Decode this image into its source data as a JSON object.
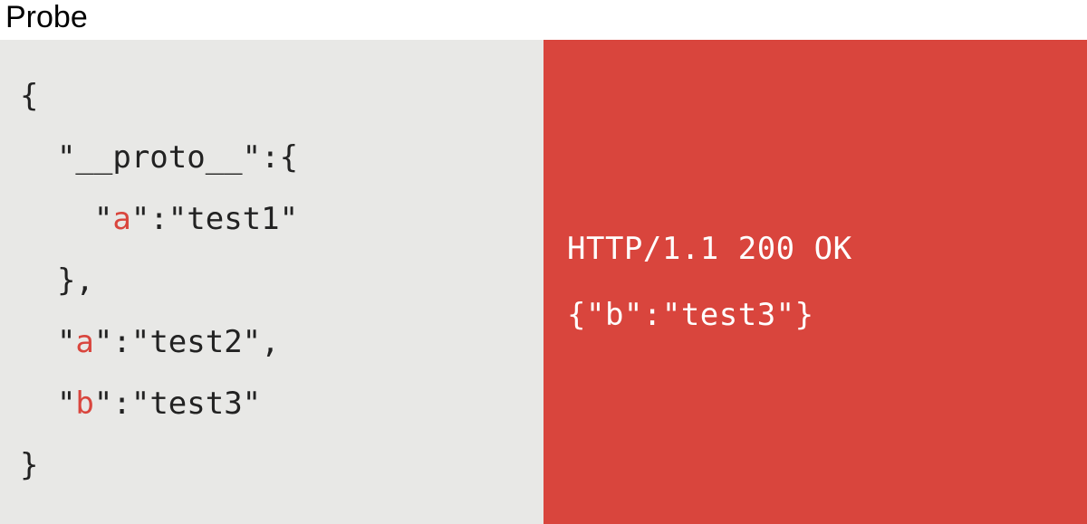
{
  "title": "Probe",
  "request": {
    "open_brace": "{",
    "proto_open": "  \"__proto__\":{",
    "proto_inner_prefix": "    \"",
    "proto_inner_key": "a",
    "proto_inner_suffix": "\":\"test1\"",
    "proto_close": "  },",
    "key_a_prefix": "  \"",
    "key_a": "a",
    "key_a_suffix": "\":\"test2\",",
    "key_b_prefix": "  \"",
    "key_b": "b",
    "key_b_suffix": "\":\"test3\"",
    "close_brace": "}"
  },
  "response": {
    "status_line": "HTTP/1.1 200 OK",
    "body": "{\"b\":\"test3\"}"
  }
}
